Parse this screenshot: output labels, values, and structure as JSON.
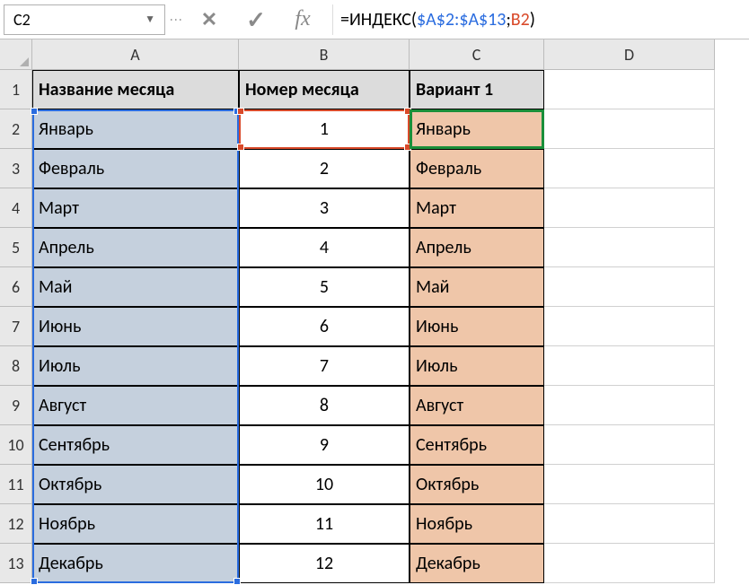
{
  "nameBox": {
    "value": "C2"
  },
  "formulaBar": {
    "prefix": "=",
    "functionName": "ИНДЕКС",
    "openParen": "(",
    "absRange": "$A$2:$A$13",
    "separator": ";",
    "relRef": "B2",
    "closeParen": ")"
  },
  "columns": [
    "A",
    "B",
    "C",
    "D"
  ],
  "rowNumbers": [
    "1",
    "2",
    "3",
    "4",
    "5",
    "6",
    "7",
    "8",
    "9",
    "10",
    "11",
    "12",
    "13"
  ],
  "headers": {
    "A": "Название месяца",
    "B": "Номер месяца",
    "C": "Вариант 1"
  },
  "rows": [
    {
      "a": "Январь",
      "b": "1",
      "c": "Январь"
    },
    {
      "a": "Февраль",
      "b": "2",
      "c": "Февраль"
    },
    {
      "a": "Март",
      "b": "3",
      "c": "Март"
    },
    {
      "a": "Апрель",
      "b": "4",
      "c": "Апрель"
    },
    {
      "a": "Май",
      "b": "5",
      "c": "Май"
    },
    {
      "a": "Июнь",
      "b": "6",
      "c": "Июнь"
    },
    {
      "a": "Июль",
      "b": "7",
      "c": "Июль"
    },
    {
      "a": "Август",
      "b": "8",
      "c": "Август"
    },
    {
      "a": "Сентябрь",
      "b": "9",
      "c": "Сентябрь"
    },
    {
      "a": "Октябрь",
      "b": "10",
      "c": "Октябрь"
    },
    {
      "a": "Ноябрь",
      "b": "11",
      "c": "Ноябрь"
    },
    {
      "a": "Декабрь",
      "b": "12",
      "c": "Декабрь"
    }
  ],
  "icons": {
    "cancel": "✕",
    "confirm": "✓",
    "fx": "fx",
    "dropdown": "▼"
  }
}
